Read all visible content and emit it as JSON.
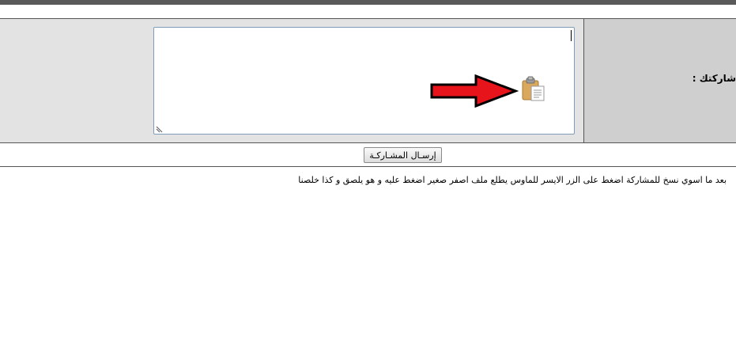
{
  "form": {
    "label": "شاركتك :",
    "textarea_value": "",
    "submit_label": "إرسـال المشـاركـة"
  },
  "instruction": "بعد ما اسوي نسخ للمشاركة اضغط على الزر الايسر للماوس يطلع ملف اصفر صغير اضغط عليه و هو يلصق و كذا خلصنا",
  "icons": {
    "arrow": "red-arrow-icon",
    "clipboard": "clipboard-paste-icon"
  },
  "colors": {
    "arrow_fill": "#e8141c",
    "arrow_outline": "#000000",
    "textarea_border": "#7f9db9",
    "form_bg": "#e3e3e3",
    "label_bg": "#cfcfcf"
  }
}
